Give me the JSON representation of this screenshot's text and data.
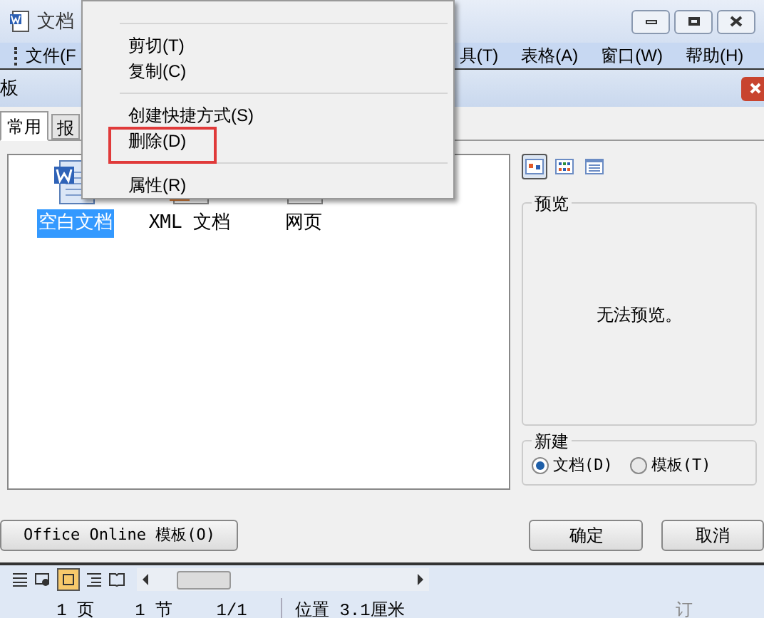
{
  "window": {
    "title": "文档"
  },
  "menu_bar": [
    {
      "label": "文件(F"
    },
    {
      "label": "具(T)"
    },
    {
      "label": "表格(A)"
    },
    {
      "label": "窗口(W)"
    },
    {
      "label": "帮助(H)"
    }
  ],
  "context_menu": {
    "items": [
      {
        "kind": "separator"
      },
      {
        "kind": "item",
        "label": "剪切(T)",
        "highlighted": false
      },
      {
        "kind": "item",
        "label": "复制(C)",
        "highlighted": false
      },
      {
        "kind": "separator"
      },
      {
        "kind": "item",
        "label": "创建快捷方式(S)",
        "highlighted": false
      },
      {
        "kind": "item",
        "label": "删除(D)",
        "highlighted": true
      },
      {
        "kind": "separator"
      },
      {
        "kind": "item",
        "label": "属性(R)",
        "highlighted": false
      }
    ]
  },
  "dialog": {
    "title": "板",
    "tabs": [
      {
        "label": "常用",
        "selected": true
      },
      {
        "label": "报",
        "selected": false
      }
    ],
    "templates": [
      {
        "kind": "word",
        "label": "空白文档",
        "selected": true
      },
      {
        "kind": "xml",
        "label": "XML 文档",
        "selected": false
      },
      {
        "kind": "web",
        "label": "网页",
        "selected": false
      }
    ],
    "view_buttons": [
      {
        "kind": "large",
        "selected": true
      },
      {
        "kind": "small",
        "selected": false
      },
      {
        "kind": "list",
        "selected": false
      }
    ],
    "preview": {
      "title": "预览",
      "message": "无法预览。"
    },
    "create_new": {
      "title": "新建",
      "options": [
        {
          "label": "文档(D)",
          "selected": true
        },
        {
          "label": "模板(T)",
          "selected": false
        }
      ]
    },
    "buttons": [
      {
        "label": "Office Online 模板(O)"
      },
      {
        "label": "确定"
      },
      {
        "label": "取消"
      }
    ]
  },
  "status_bar": {
    "fields": [
      "1 页",
      "1 节",
      "1/1",
      "位置 3.1厘米",
      "订"
    ]
  }
}
